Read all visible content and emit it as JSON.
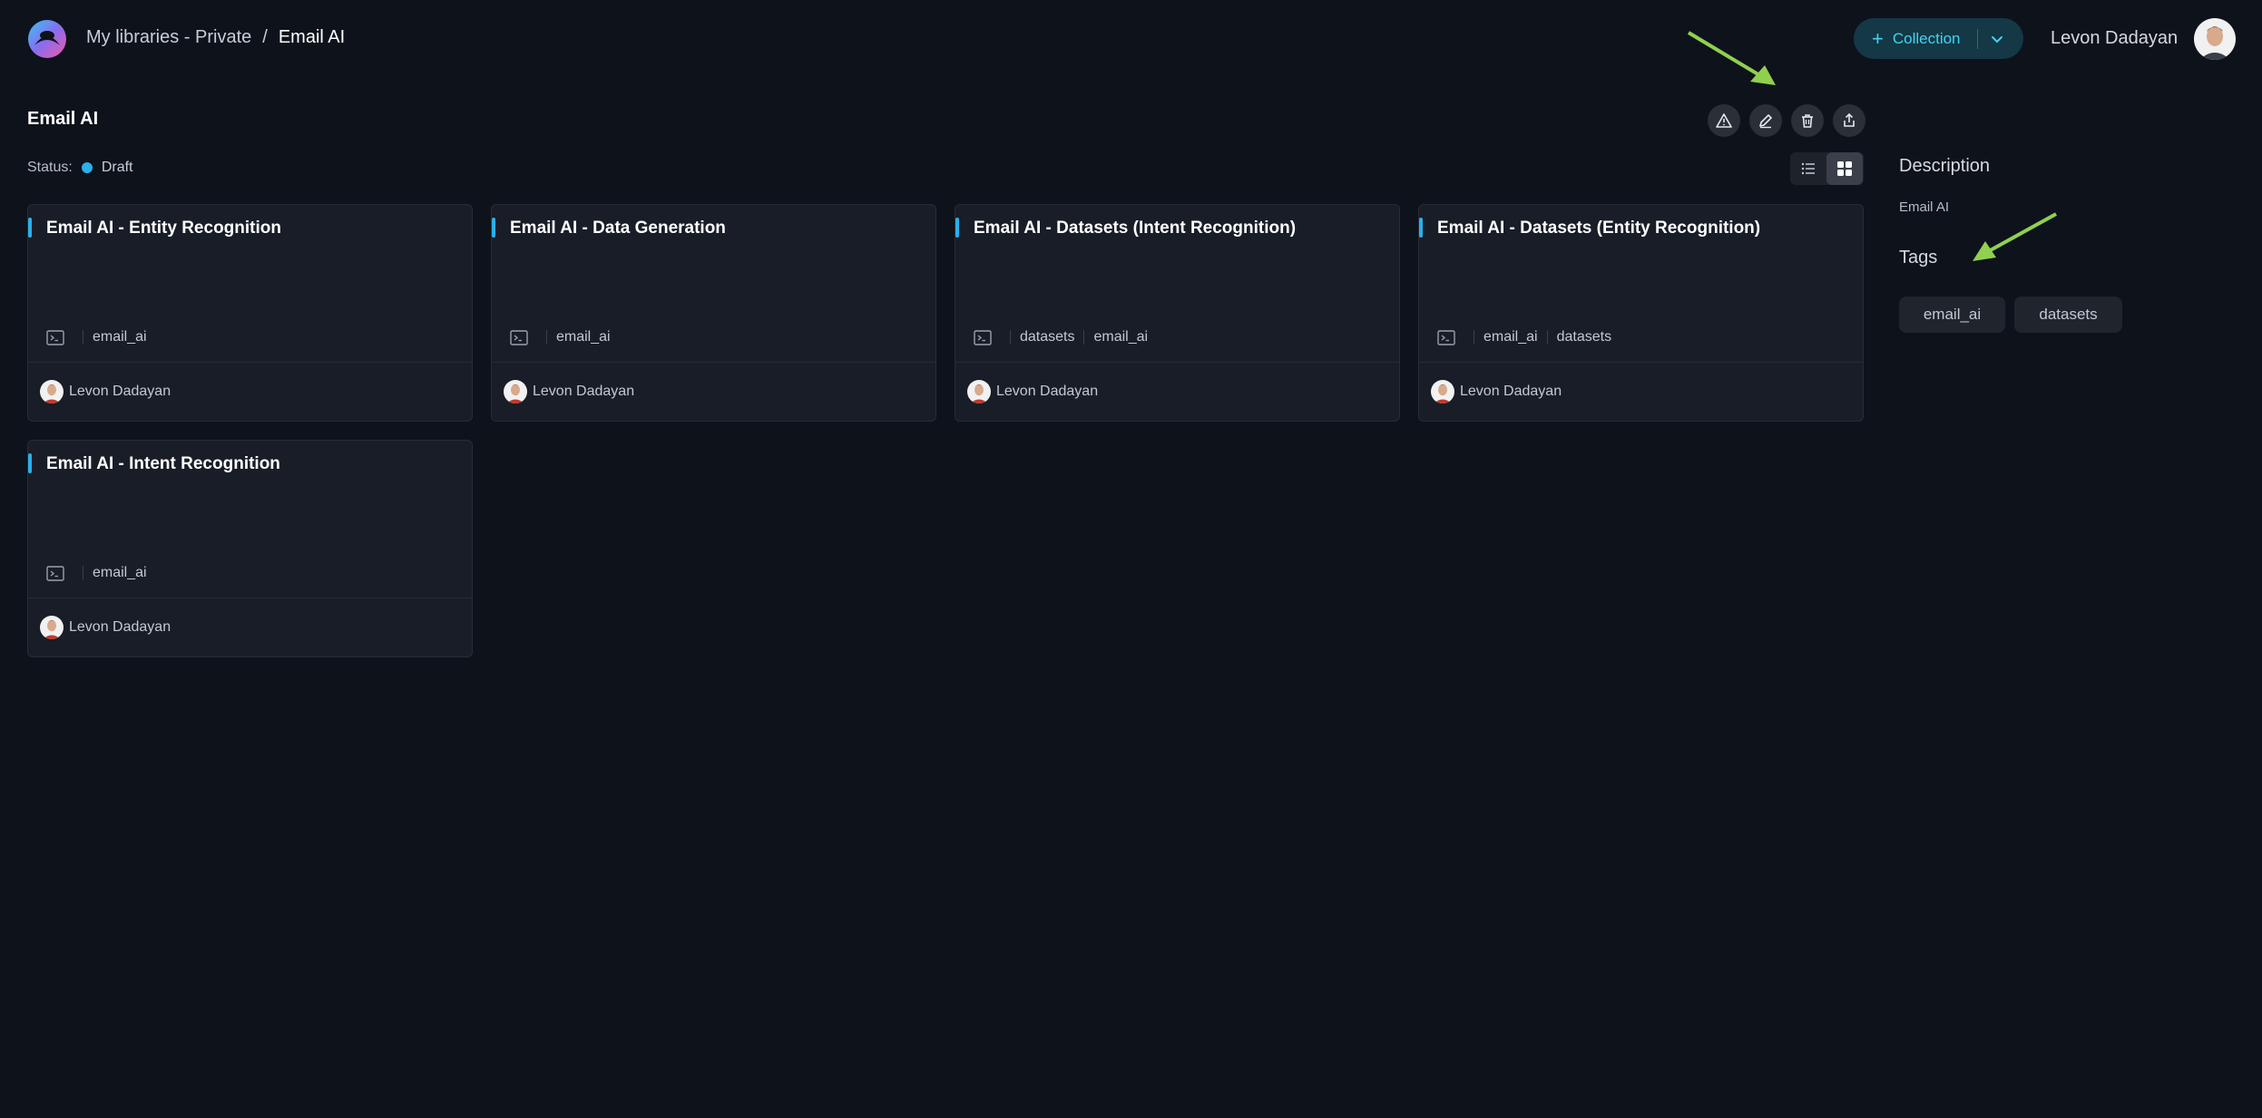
{
  "header": {
    "breadcrumb": [
      "My libraries - Private",
      "Email AI"
    ],
    "breadcrumb_separator": "/",
    "collection_button": "Collection",
    "user_name": "Levon Dadayan"
  },
  "page": {
    "title": "Email AI",
    "status_label": "Status:",
    "status_value": "Draft",
    "status_color": "#2ab0ea",
    "actions": [
      "warning-icon",
      "edit-icon",
      "trash-icon",
      "share-icon"
    ],
    "view_modes": [
      "list-view-icon",
      "grid-view-icon"
    ],
    "active_view": "grid"
  },
  "cards": [
    {
      "title": "Email AI - Entity Recognition",
      "tags": [
        "email_ai"
      ],
      "author": "Levon Dadayan"
    },
    {
      "title": "Email AI - Data Generation",
      "tags": [
        "email_ai"
      ],
      "author": "Levon Dadayan"
    },
    {
      "title": "Email AI - Datasets (Intent Recognition)",
      "tags": [
        "datasets",
        "email_ai"
      ],
      "author": "Levon Dadayan"
    },
    {
      "title": "Email AI - Datasets (Entity Recognition)",
      "tags": [
        "email_ai",
        "datasets"
      ],
      "author": "Levon Dadayan"
    },
    {
      "title": "Email AI - Intent Recognition",
      "tags": [
        "email_ai"
      ],
      "author": "Levon Dadayan"
    }
  ],
  "sidebar": {
    "description_heading": "Description",
    "description_value": "Email AI",
    "tags_heading": "Tags",
    "tags": [
      "email_ai",
      "datasets"
    ]
  },
  "colors": {
    "accent": "#2ab0ea",
    "annotation_arrow": "#8fd14f",
    "background": "#0e121b"
  }
}
